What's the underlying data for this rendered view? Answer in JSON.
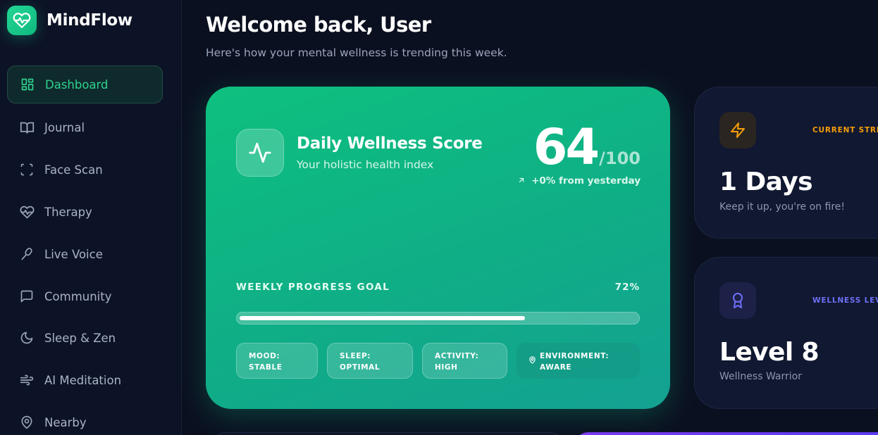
{
  "brand": {
    "name": "MindFlow",
    "logo_icon": "heart-pulse-icon",
    "accent": "#10b981"
  },
  "sidebar": {
    "items": [
      {
        "label": "Dashboard",
        "icon": "grid-icon",
        "active": true
      },
      {
        "label": "Journal",
        "icon": "book-icon"
      },
      {
        "label": "Face Scan",
        "icon": "scan-icon"
      },
      {
        "label": "Therapy",
        "icon": "heart-pulse-icon"
      },
      {
        "label": "Live Voice",
        "icon": "mic-icon"
      },
      {
        "label": "Community",
        "icon": "chat-icon"
      },
      {
        "label": "Sleep & Zen",
        "icon": "moon-icon"
      },
      {
        "label": "AI Meditation",
        "icon": "wind-icon"
      },
      {
        "label": "Nearby",
        "icon": "map-pin-icon"
      }
    ]
  },
  "header": {
    "title": "Welcome back, User",
    "subtitle": "Here's how your mental wellness is trending this week."
  },
  "wellness": {
    "title": "Daily Wellness Score",
    "subtitle": "Your holistic health index",
    "score": "64",
    "max": "/100",
    "delta": "+0% from yesterday",
    "goal_label": "WEEKLY PROGRESS GOAL",
    "goal_pct_text": "72%",
    "goal_fraction": 0.72,
    "chips": [
      {
        "line1": "MOOD:",
        "line2": "STABLE"
      },
      {
        "line1": "SLEEP:",
        "line2": "OPTIMAL"
      },
      {
        "line1": "ACTIVITY:",
        "line2": "HIGH"
      },
      {
        "line1": "ENVIRONMENT:",
        "line2": "AWARE",
        "icon": "map-pin-icon"
      }
    ]
  },
  "streak": {
    "tag": "CURRENT STREAK",
    "value": "1 Days",
    "caption": "Keep it up, you're on fire!",
    "icon": "lightning-icon",
    "color": "#f59e0b"
  },
  "level": {
    "tag": "WELLNESS LEVEL",
    "value": "Level 8",
    "caption": "Wellness Warrior",
    "icon": "award-icon",
    "color": "#6366f1"
  }
}
